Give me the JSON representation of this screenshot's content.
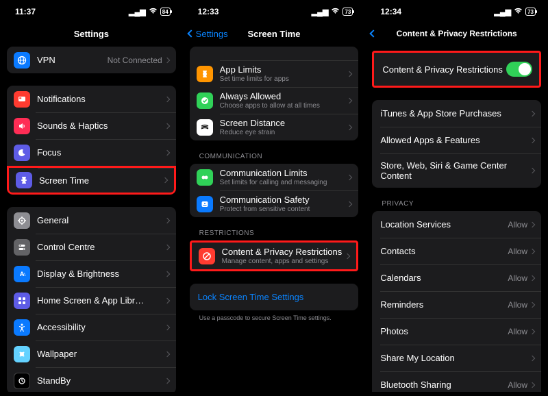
{
  "phone1": {
    "time": "11:37",
    "battery": "84",
    "title": "Settings",
    "vpn": {
      "label": "VPN",
      "detail": "Not Connected"
    },
    "group2": [
      {
        "label": "Notifications"
      },
      {
        "label": "Sounds & Haptics"
      },
      {
        "label": "Focus"
      },
      {
        "label": "Screen Time"
      }
    ],
    "group3": [
      {
        "label": "General"
      },
      {
        "label": "Control Centre"
      },
      {
        "label": "Display & Brightness"
      },
      {
        "label": "Home Screen & App Library"
      },
      {
        "label": "Accessibility"
      },
      {
        "label": "Wallpaper"
      },
      {
        "label": "StandBy"
      }
    ]
  },
  "phone2": {
    "time": "12:33",
    "battery": "73",
    "back": "Settings",
    "title": "Screen Time",
    "limits": [
      {
        "label": "App Limits",
        "sub": "Set time limits for apps"
      },
      {
        "label": "Always Allowed",
        "sub": "Choose apps to allow at all times"
      },
      {
        "label": "Screen Distance",
        "sub": "Reduce eye strain"
      }
    ],
    "comm_header": "COMMUNICATION",
    "comm": [
      {
        "label": "Communication Limits",
        "sub": "Set limits for calling and messaging"
      },
      {
        "label": "Communication Safety",
        "sub": "Protect from sensitive content"
      }
    ],
    "restr_header": "RESTRICTIONS",
    "restr": {
      "label": "Content & Privacy Restrictions",
      "sub": "Manage content, apps and settings"
    },
    "lock": "Lock Screen Time Settings",
    "footer": "Use a passcode to secure Screen Time settings."
  },
  "phone3": {
    "time": "12:34",
    "battery": "73",
    "title": "Content & Privacy Restrictions",
    "toggle_label": "Content & Privacy Restrictions",
    "group2": [
      {
        "label": "iTunes & App Store Purchases"
      },
      {
        "label": "Allowed Apps & Features"
      },
      {
        "label": "Store, Web, Siri & Game Center Content"
      }
    ],
    "privacy_header": "PRIVACY",
    "privacy": [
      {
        "label": "Location Services",
        "detail": "Allow"
      },
      {
        "label": "Contacts",
        "detail": "Allow"
      },
      {
        "label": "Calendars",
        "detail": "Allow"
      },
      {
        "label": "Reminders",
        "detail": "Allow"
      },
      {
        "label": "Photos",
        "detail": "Allow"
      },
      {
        "label": "Share My Location",
        "detail": ""
      },
      {
        "label": "Bluetooth Sharing",
        "detail": "Allow"
      }
    ]
  }
}
